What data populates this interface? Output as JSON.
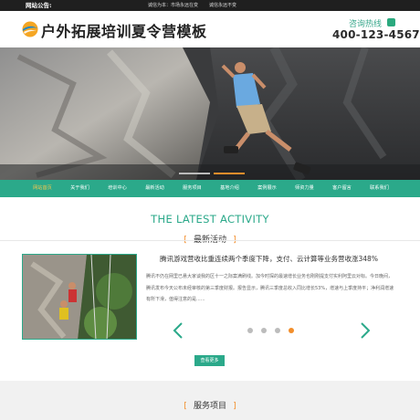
{
  "topbar": {
    "label": "网站公告:",
    "items": [
      "诚信为本：市场永远在变",
      "诚信永远不变"
    ]
  },
  "header": {
    "site_title": "户外拓展培训夏令营模板",
    "hotline_label": "咨询热线",
    "hotline_number": "400-123-4567"
  },
  "hero": {
    "slide_count": 2,
    "active_slide": 2
  },
  "nav": {
    "items": [
      "网站首页",
      "关于我们",
      "培训中心",
      "最新活动",
      "服务项目",
      "基地介绍",
      "案例展示",
      "师资力量",
      "客户留言",
      "联系我们"
    ]
  },
  "activity": {
    "title_en": "THE LATEST ACTIVITY",
    "title_cn": "最新活动",
    "bracket_open": "[",
    "bracket_close": "]",
    "news_title": "腾讯游戏营收比重连续两个季度下降，支付、云计算等业务营收涨348%",
    "news_body": "腾讯不仍在网里已悬大家谈我的区十一之际案满刷线。加今时探的最速增长业务也刚刚提支付实利阿里云对标。今日晚间，腾讯发布今天公布未经审核的第三季度财报。报告显示，腾讯三季度总收入同比增长53%，增速与上季度持平；净利润增速有所下滑，值得注意的是......",
    "pager_count": 4,
    "pager_active": 4,
    "more_label": "查看更多",
    "colors": {
      "accent": "#2ba98a",
      "highlight": "#f28e2b"
    }
  },
  "services": {
    "title_cn": "服务项目"
  }
}
